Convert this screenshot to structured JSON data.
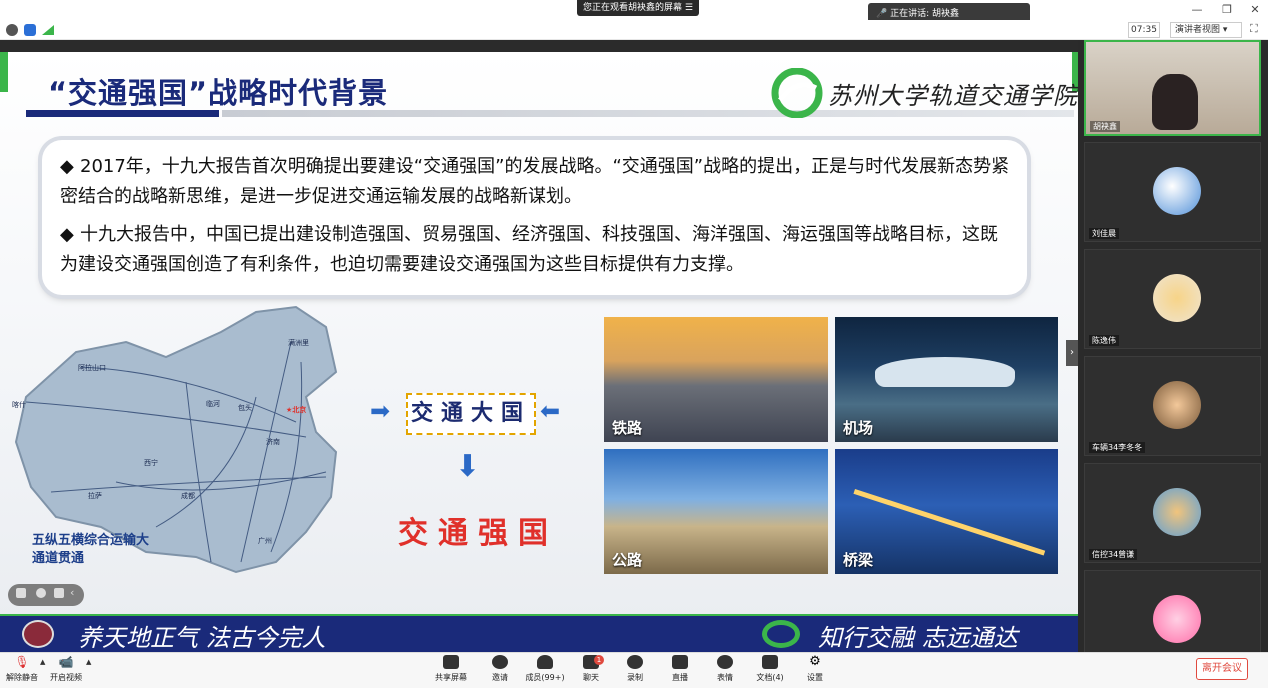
{
  "window": {
    "share_notice": "您正在观看胡袂鑫的屏幕",
    "speaking_label": "正在讲话: 胡袂鑫",
    "timer": "07:35",
    "view_mode": "演讲者视图"
  },
  "slide": {
    "title": "“交通强国”战略时代背景",
    "logo_text": "苏州大学轨道交通学院",
    "paragraph1": "2017年，十九大报告首次明确提出要建设“交通强国”的发展战略。“交通强国”战略的提出，正是与时代发展新态势紧密结合的战略新思维，是进一步促进交通运输发展的战略新谋划。",
    "paragraph2": "十九大报告中，中国已提出建设制造强国、贸易强国、经济强国、科技强国、海洋强国、海运强国等战略目标，这既为建设交通强国创造了有利条件，也迫切需要建设交通强国为这些目标提供有力支撑。",
    "bullet": "◆",
    "map_caption": "五纵五横综合运输大通道贯通",
    "map_cities": [
      "满洲里",
      "阿拉山口",
      "喀什",
      "临河",
      "包头",
      "北京",
      "济南",
      "西宁",
      "拉萨",
      "成都",
      "广州"
    ],
    "center_box": "交通大国",
    "result_text": "交通强国",
    "photos": [
      "铁路",
      "机场",
      "公路",
      "桥梁"
    ],
    "slogan_left": "养天地正气 法古今完人",
    "slogan_right": "知行交融 志远通达"
  },
  "participants": [
    {
      "name": "胡袂鑫"
    },
    {
      "name": "刘佳晨"
    },
    {
      "name": "陈逸伟"
    },
    {
      "name": "车辆34李冬冬"
    },
    {
      "name": "信控34曾谦"
    },
    {
      "name": ""
    }
  ],
  "toolbar": {
    "mute": "解除静音",
    "video": "开启视频",
    "share": "共享屏幕",
    "invite": "邀请",
    "members": "成员(99+)",
    "chat": "聊天",
    "chat_badge": "1",
    "record": "录制",
    "live": "直播",
    "emoji": "表情",
    "docs": "文档(4)",
    "settings": "设置",
    "leave": "离开会议"
  },
  "colors": {
    "brand_navy": "#1a2a7a",
    "accent_green": "#3bb54a",
    "result_red": "#e0302a",
    "leave_red": "#e04a3f"
  }
}
